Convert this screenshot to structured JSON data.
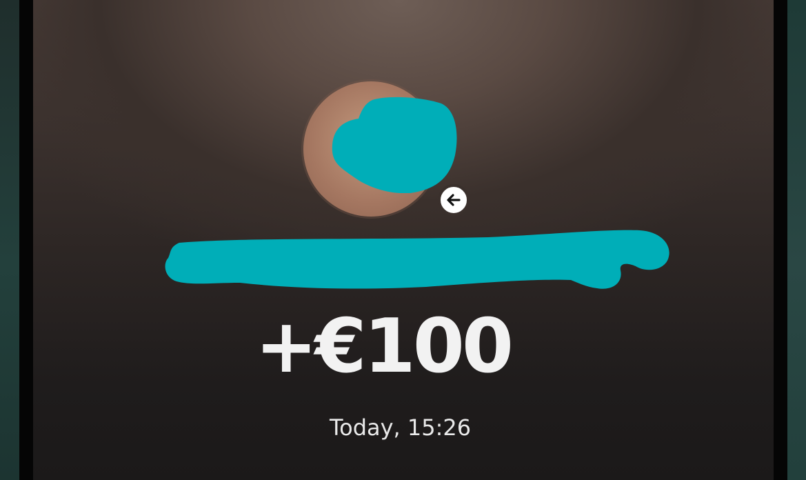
{
  "transaction": {
    "direction_icon": "arrow-left-icon",
    "amount": "+€100",
    "timestamp": "Today, 15:26"
  },
  "colors": {
    "redaction": "#00aeb8",
    "amount_text": "#f2f2f2",
    "badge_background": "#ffffff"
  }
}
